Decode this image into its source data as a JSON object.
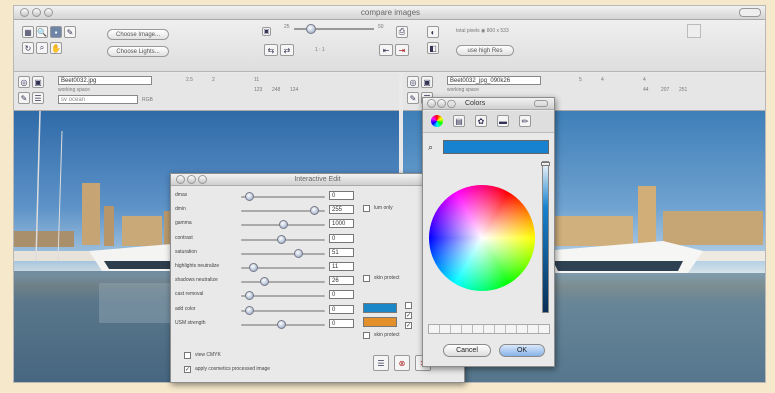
{
  "window": {
    "title": "compare images"
  },
  "toolbar": {
    "choose_image": "Choose Image...",
    "choose_lights": "Choose Lights...",
    "ratio": "1 : 1",
    "slider_min": "25",
    "slider_max": "50",
    "image_pane_info": "total pixels   ◉ 800 x 533",
    "use_high_res": "use high Res"
  },
  "left_pane": {
    "filename": "Beet0032.jpg",
    "working_space": "working space",
    "profile": "sv ocean",
    "color_model": "RGB",
    "values": [
      "2.5",
      "2",
      "11",
      "123",
      "248",
      "124"
    ]
  },
  "right_pane": {
    "filename": "Beet0032_jpg_090k26",
    "working_space": "working space",
    "values": [
      "5",
      "4",
      "4",
      "44",
      "207",
      "251"
    ]
  },
  "interactive_edit": {
    "title": "Interactive Edit",
    "rows": [
      {
        "label": "dmax",
        "value": "0",
        "pos": 0.05
      },
      {
        "label": "dmin",
        "value": "255",
        "pos": 0.92
      },
      {
        "label": "gamma",
        "value": "1000",
        "pos": 0.5
      },
      {
        "label": "contrast",
        "value": "0",
        "pos": 0.48
      },
      {
        "label": "saturation",
        "value": "51",
        "pos": 0.7
      },
      {
        "label": "highlights neutralize",
        "value": "11",
        "pos": 0.1
      },
      {
        "label": "shadows neutralize",
        "value": "26",
        "pos": 0.25
      },
      {
        "label": "cast removal",
        "value": "0",
        "pos": 0.05
      },
      {
        "label": "add color",
        "value": "0",
        "pos": 0.05
      },
      {
        "label": "USM strength",
        "value": "0",
        "pos": 0.48
      }
    ],
    "lum_only": "lum only",
    "skin_protect": "skin protect",
    "skin_protect_2": "skin protect",
    "view_cmyk": "view CMYK",
    "apply": "apply cosmetics processed image",
    "cast_color": "#1b86c8",
    "add_color": "#e4902b"
  },
  "colors_dialog": {
    "title": "Colors",
    "swatch": "#1782cf",
    "cancel": "Cancel",
    "ok": "OK"
  }
}
